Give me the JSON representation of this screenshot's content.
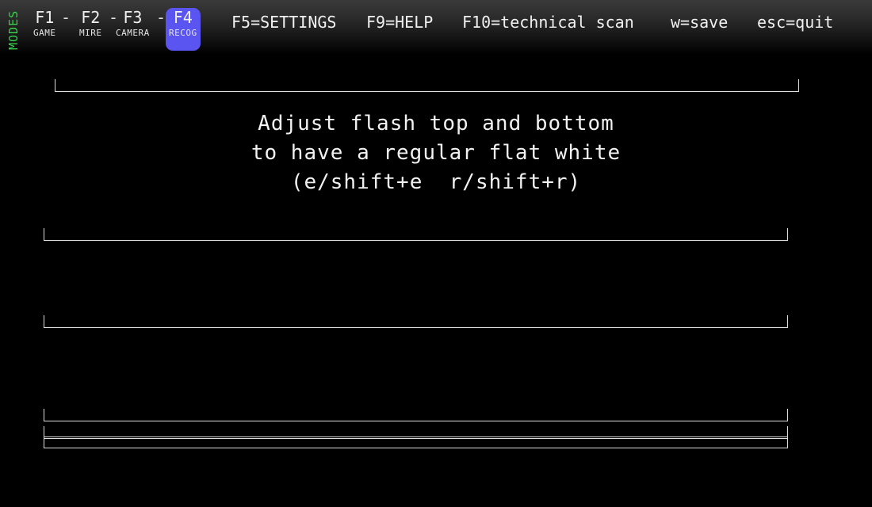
{
  "modes_label": "MODES",
  "modes": [
    {
      "key": "F1",
      "sub": "GAME"
    },
    {
      "key": "F2",
      "sub": "MIRE"
    },
    {
      "key": "F3",
      "sub": "CAMERA"
    },
    {
      "key": "F4",
      "sub": "RECOG"
    }
  ],
  "separator": "-",
  "commands": {
    "settings": "F5=SETTINGS",
    "help": "F9=HELP",
    "tech_scan": "F10=technical scan",
    "save": "w=save",
    "quit": "esc=quit"
  },
  "instructions": {
    "line1": "Adjust flash top and bottom",
    "line2": "to have a regular flat white",
    "line3": "(e/shift+e  r/shift+r)"
  },
  "colors": {
    "active_mode_bg": "#5a55f0",
    "modes_label": "#35d24a"
  }
}
